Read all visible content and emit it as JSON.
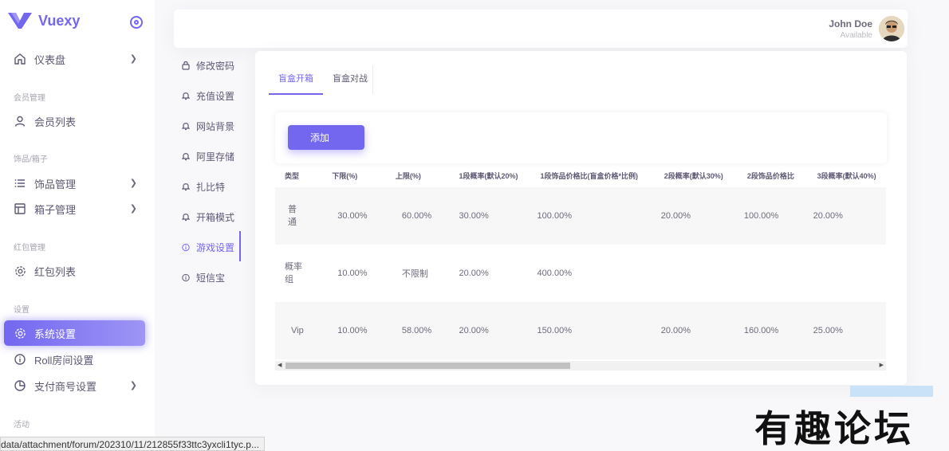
{
  "brand": {
    "name": "Vuexy",
    "accent": "#7367f0"
  },
  "sidebar": {
    "items": [
      {
        "label": "仪表盘",
        "icon": "home-icon",
        "has_chevron": true
      },
      {
        "header": "会员管理"
      },
      {
        "label": "会员列表",
        "icon": "user-icon"
      },
      {
        "header": "饰品/箱子"
      },
      {
        "label": "饰品管理",
        "icon": "list-icon",
        "has_chevron": true
      },
      {
        "label": "箱子管理",
        "icon": "layout-icon",
        "has_chevron": true
      },
      {
        "header": "红包管理"
      },
      {
        "label": "红包列表",
        "icon": "gear-icon"
      },
      {
        "header": "设置"
      },
      {
        "label": "系统设置",
        "icon": "gear-icon",
        "active": true
      },
      {
        "label": "Roll房间设置",
        "icon": "info-icon"
      },
      {
        "label": "支付商号设置",
        "icon": "pie-chart-icon",
        "has_chevron": true
      },
      {
        "header": "活动"
      }
    ]
  },
  "header": {
    "user_name": "John Doe",
    "user_status": "Available"
  },
  "settings_menu": [
    {
      "label": "修改密码",
      "icon": "lock-icon"
    },
    {
      "label": "充值设置",
      "icon": "bell-icon"
    },
    {
      "label": "网站背景",
      "icon": "bell-icon"
    },
    {
      "label": "阿里存储",
      "icon": "bell-icon"
    },
    {
      "label": "扎比特",
      "icon": "bell-icon"
    },
    {
      "label": "开箱模式",
      "icon": "bell-icon"
    },
    {
      "label": "游戏设置",
      "icon": "info-icon",
      "active": true
    },
    {
      "label": "短信宝",
      "icon": "info-icon"
    }
  ],
  "tabs": [
    {
      "label": "盲盒开箱",
      "active": true
    },
    {
      "label": "盲盒对战"
    }
  ],
  "add_button": "添加",
  "table": {
    "columns": [
      "类型",
      "下限(%)",
      "上限(%)",
      "1段概率(默认20%)",
      "1段饰品价格比(盲盒价格*比例)",
      "2段概率(默认30%)",
      "2段饰品价格比",
      "3段概率(默认40%)"
    ],
    "rows": [
      {
        "type_l1": "普",
        "type_l2": "通",
        "cells": [
          "30.00%",
          "60.00%",
          "30.00%",
          "100.00%",
          "20.00%",
          "100.00%",
          "20.00%"
        ]
      },
      {
        "type_l1": "概率",
        "type_l2": "组",
        "cells": [
          "10.00%",
          "不限制",
          "20.00%",
          "400.00%",
          "",
          "",
          ""
        ]
      },
      {
        "type_l1": "Vip",
        "type_l2": "",
        "cells": [
          "10.00%",
          "58.00%",
          "20.00%",
          "150.00%",
          "20.00%",
          "160.00%",
          "25.00%"
        ]
      }
    ]
  },
  "status_url": "data/attachment/forum/202310/11/212855f33ttc3yxcli1tyc.p...",
  "watermark": "有趣论坛"
}
